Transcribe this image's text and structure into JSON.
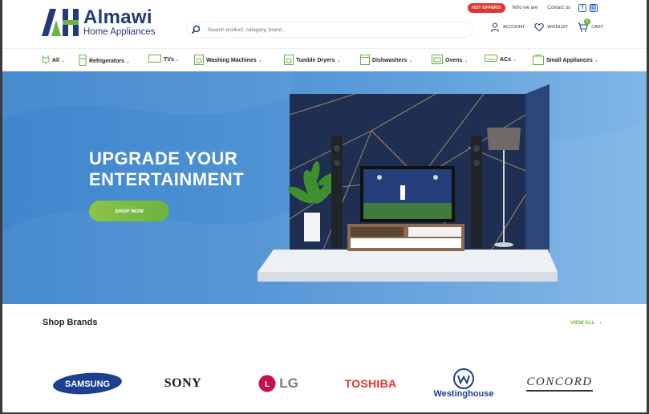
{
  "header": {
    "logo": {
      "name": "Almawi",
      "subtitle": "Home Appliances"
    },
    "search": {
      "placeholder": "Search product, category, brand..."
    },
    "toplinks": {
      "offers": "HOT OFFERS!",
      "who_we_are": "Who we are",
      "contact": "Contact us"
    },
    "account": "ACCOUNT",
    "wishlist": "WISHLIST",
    "cart": "CART",
    "cart_count": "0"
  },
  "nav": {
    "items": [
      {
        "label": "All",
        "icon": "plug-icon"
      },
      {
        "label": "Refrigerators",
        "icon": "refrigerator-icon"
      },
      {
        "label": "TVs",
        "icon": "tv-icon"
      },
      {
        "label": "Washing Machines",
        "icon": "washing-machine-icon"
      },
      {
        "label": "Tumble Dryers",
        "icon": "dryer-icon"
      },
      {
        "label": "Dishwashers",
        "icon": "dishwasher-icon"
      },
      {
        "label": "Ovens",
        "icon": "oven-icon"
      },
      {
        "label": "ACs",
        "icon": "ac-icon"
      },
      {
        "label": "Small Appliances",
        "icon": "small-appliances-icon"
      }
    ]
  },
  "hero": {
    "title_line1": "UPGRADE YOUR",
    "title_line2": "ENTERTAINMENT",
    "button": "SHOP NOW"
  },
  "brands": {
    "title": "Shop Brands",
    "view_all": "VIEW ALL",
    "items": [
      "SAMSUNG",
      "SONY",
      "LG",
      "TOSHIBA",
      "Westinghouse",
      "CONCORD"
    ]
  },
  "colors": {
    "accent_green": "#6cb33f",
    "brand_blue": "#243a78",
    "hero_blue": "#4a8fd3",
    "offers_red": "#e4352b"
  }
}
